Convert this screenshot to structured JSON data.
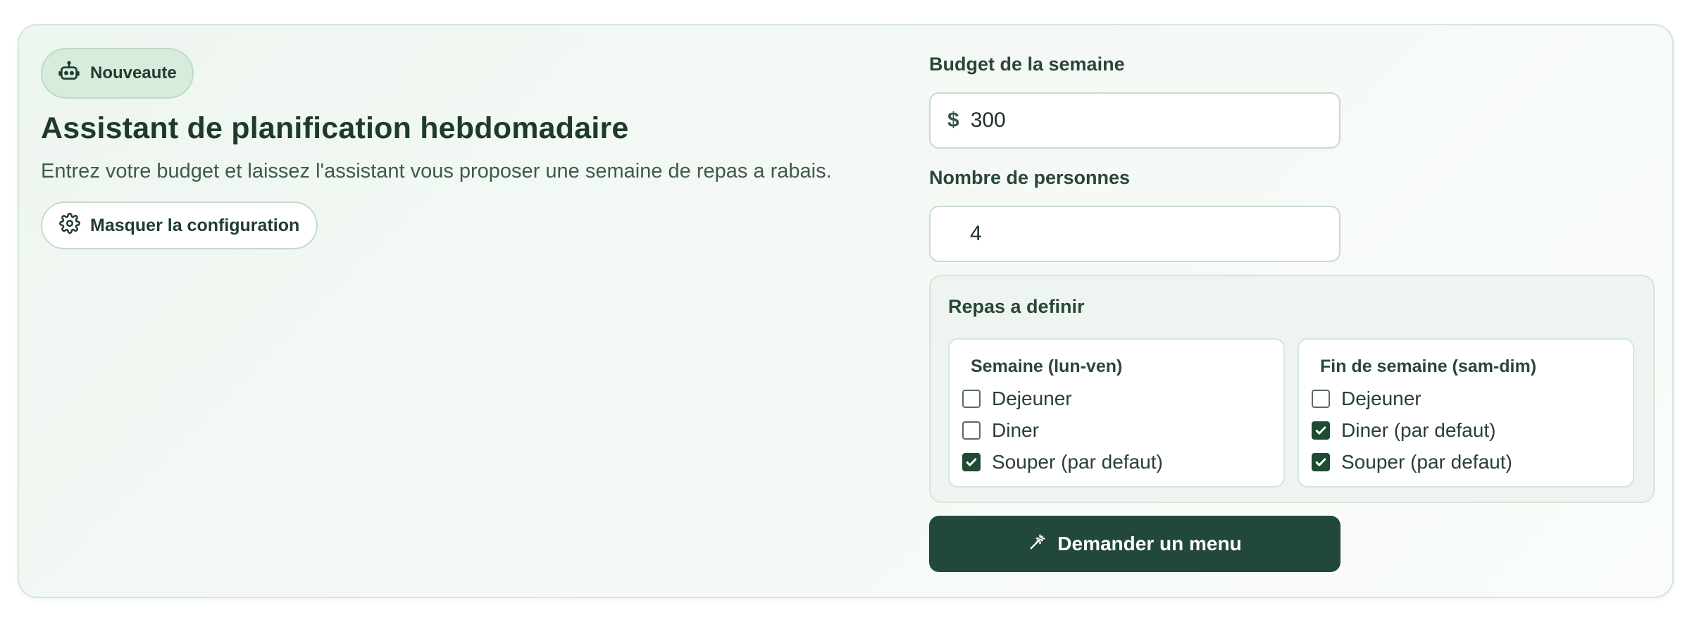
{
  "header": {
    "badge": "Nouveaute",
    "badge_icon": "robot-icon",
    "title": "Assistant de planification hebdomadaire",
    "subtitle": "Entrez votre budget et laissez l'assistant vous proposer une semaine de repas a rabais.",
    "config_button": "Masquer la configuration",
    "config_icon": "gear-icon"
  },
  "form": {
    "budget_label": "Budget de la semaine",
    "currency": "$",
    "budget_value": "300",
    "people_label": "Nombre de personnes",
    "people_value": "4",
    "meals_title": "Repas a definir",
    "weekday": {
      "title": "Semaine (lun-ven)",
      "options": [
        {
          "label": "Dejeuner",
          "checked": false
        },
        {
          "label": "Diner",
          "checked": false
        },
        {
          "label": "Souper (par defaut)",
          "checked": true
        }
      ]
    },
    "weekend": {
      "title": "Fin de semaine (sam-dim)",
      "options": [
        {
          "label": "Dejeuner",
          "checked": false
        },
        {
          "label": "Diner (par defaut)",
          "checked": true
        },
        {
          "label": "Souper (par defaut)",
          "checked": true
        }
      ]
    },
    "submit_label": "Demander un menu",
    "submit_icon": "magic-wand-icon"
  },
  "colors": {
    "accent": "#22483a",
    "badge_bg": "#d7ecdd",
    "card_bg": "#eef6f0"
  }
}
